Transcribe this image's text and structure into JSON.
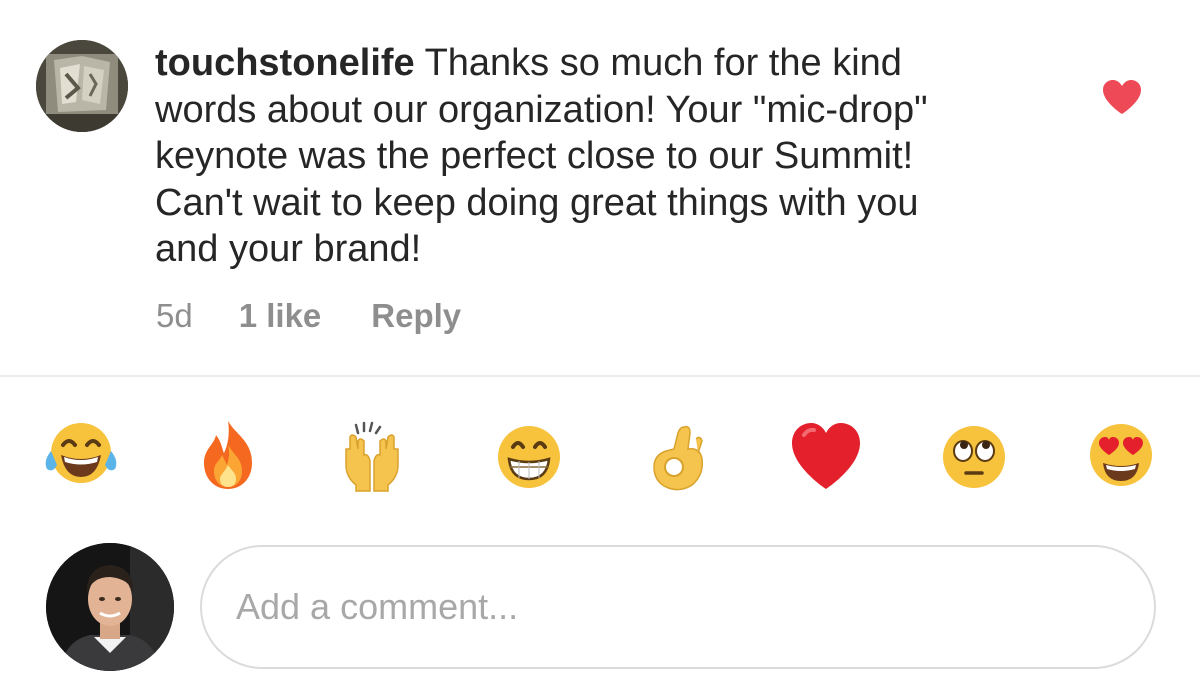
{
  "comment": {
    "username": "touchstonelife",
    "text_lines": [
      "Thanks so much for the kind",
      "words about our organization! Your \"mic-drop\"",
      "keynote was the perfect close to our Summit!",
      "Can't wait to keep doing great things with you",
      "and your brand!"
    ],
    "time": "5d",
    "likes": "1 like",
    "reply_label": "Reply",
    "liked": true,
    "like_color": "#ed4956"
  },
  "emoji_bar": [
    {
      "name": "face-with-tears-of-joy",
      "char": "😂"
    },
    {
      "name": "fire",
      "char": "🔥"
    },
    {
      "name": "raising-hands",
      "char": "🙌"
    },
    {
      "name": "grinning-face",
      "char": "😁"
    },
    {
      "name": "ok-hand",
      "char": "👌"
    },
    {
      "name": "red-heart",
      "char": "❤️"
    },
    {
      "name": "face-with-rolling-eyes",
      "char": "🙄"
    },
    {
      "name": "smiling-face-with-heart-eyes",
      "char": "😍"
    }
  ],
  "composer": {
    "placeholder": "Add a comment..."
  }
}
